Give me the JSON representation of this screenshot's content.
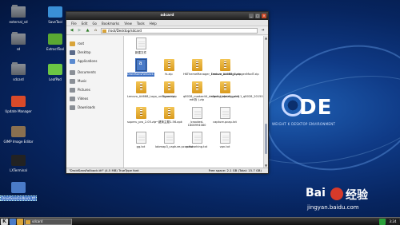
{
  "desktop": {
    "icons": [
      {
        "label": "external_sd",
        "type": "folder",
        "icon": "folder-icon"
      },
      {
        "label": "SaveTool",
        "type": "app",
        "icon": "tool-icon",
        "color": "#3a8fd6"
      },
      {
        "label": "sd",
        "type": "folder",
        "icon": "folder-icon"
      },
      {
        "label": "ExtractTool",
        "type": "app",
        "icon": "extract-icon",
        "color": "#5aa832"
      },
      {
        "label": "sdcard",
        "type": "folder",
        "icon": "folder-icon"
      },
      {
        "label": "LeafPad",
        "type": "app",
        "icon": "leafpad-icon",
        "color": "#6cc644"
      },
      {
        "label": "Update Manager",
        "type": "app",
        "icon": "update-icon",
        "color": "#d84a2a"
      },
      {
        "label": "GIMP Image Editor",
        "type": "app",
        "icon": "gimp-icon",
        "color": "#8a7050"
      },
      {
        "label": "LXTerminal",
        "type": "app",
        "icon": "terminal-icon",
        "color": "#222222"
      },
      {
        "label": "DroidSansFallback.ttf",
        "type": "file",
        "icon": "font-file-icon",
        "color": "#4a7bc8"
      }
    ],
    "kde_letters": "DE",
    "kde_tagline": "WEIGHT K DESKTOP ENVIRONMENT"
  },
  "window": {
    "title": "sdcard",
    "menu": [
      "File",
      "Edit",
      "Go",
      "Bookmarks",
      "View",
      "Tools",
      "Help"
    ],
    "address": "/root/Desktop/sdcard",
    "sidebar": [
      {
        "label": "root",
        "icon": "home-folder-icon",
        "color": "#d9a43a"
      },
      {
        "label": "Desktop",
        "icon": "desktop-icon",
        "color": "#5a6a8a"
      },
      {
        "label": "Applications",
        "icon": "applications-icon",
        "color": "#5a8ad0"
      },
      {
        "label": "Documents",
        "icon": "documents-folder-icon",
        "color": "#8a8f96",
        "gap": true
      },
      {
        "label": "Music",
        "icon": "music-folder-icon",
        "color": "#8a8f96"
      },
      {
        "label": "Pictures",
        "icon": "pictures-folder-icon",
        "color": "#8a8f96"
      },
      {
        "label": "Videos",
        "icon": "videos-folder-icon",
        "color": "#8a8f96"
      },
      {
        "label": "Downloads",
        "icon": "downloads-folder-icon",
        "color": "#8a8f96"
      }
    ],
    "files": [
      {
        "name": "新建文件",
        "kind": "doc"
      },
      {
        "name": "",
        "kind": "empty"
      },
      {
        "name": "",
        "kind": "empty"
      },
      {
        "name": "",
        "kind": "empty"
      },
      {
        "name": "",
        "kind": "empty"
      },
      {
        "name": "DroidSansFallback.ttf",
        "kind": "font",
        "selected": true
      },
      {
        "name": "fs.zip",
        "kind": "zip"
      },
      {
        "name": "HKThemeManager_Feature_bootlogo.zip",
        "kind": "zip"
      },
      {
        "name": "Lenovo_A4688_CyangenModT.zip",
        "kind": "zip"
      },
      {
        "name": "",
        "kind": "empty"
      },
      {
        "name": "Lenovo_A4688_Logo_unSigned.zip",
        "kind": "zip"
      },
      {
        "name": "liguo.zip",
        "kind": "zip"
      },
      {
        "name": "q8028_modae44_default_default_path( edt拆 ).zip",
        "kind": "zip"
      },
      {
        "name": "signed_update_cm11_q8028_20150301.zip",
        "kind": "zip"
      },
      {
        "name": "",
        "kind": "empty"
      },
      {
        "name": "superu_pro_2.05.zip",
        "kind": "zip"
      },
      {
        "name": "一键换主题1.56.apk",
        "kind": "zip"
      },
      {
        "name": "/crooked-1808994080",
        "kind": "doc"
      },
      {
        "name": "capture.pcap.txt",
        "kind": "doc"
      },
      {
        "name": "",
        "kind": "empty"
      },
      {
        "name": "gg.txt",
        "kind": "doc"
      },
      {
        "name": "labmap3_capture.pcap.txt",
        "kind": "doc"
      },
      {
        "name": "networking.txt",
        "kind": "doc"
      },
      {
        "name": "vpn.txt",
        "kind": "doc"
      }
    ],
    "status_left": "\"DroidSansFallback.ttf\" (4.5 MB) TrueType font",
    "status_right": "Free space: 2.1 GB (Total: 15.7 GB)"
  },
  "taskbar": {
    "start_label": "K",
    "task_label": "sdcard",
    "clock": "3:24"
  },
  "watermark": {
    "brand_left": "Bai",
    "brand_right": "经验",
    "url": "jingyan.baidu.com"
  },
  "colors": {
    "accent_selection": "#3d6fc2",
    "zip_icon": "#e0a82e",
    "close_button": "#c94a2a"
  }
}
